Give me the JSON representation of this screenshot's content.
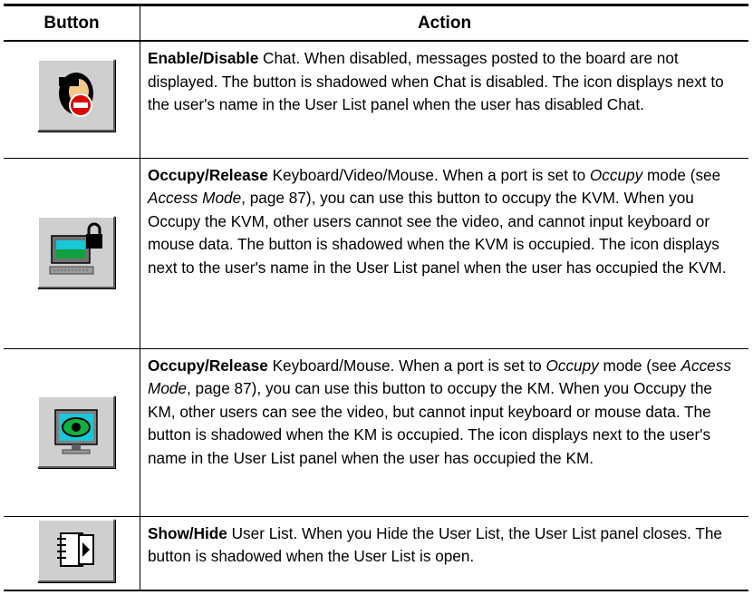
{
  "header": {
    "button": "Button",
    "action": "Action"
  },
  "rows": [
    {
      "icon": "chat-disabled-icon",
      "title": "Enable/Disable",
      "text": " Chat. When disabled, messages posted to the board are not displayed. The button is shadowed when Chat is disabled. The icon displays next to the user's name in the User List panel when the user has disabled Chat."
    },
    {
      "icon": "kvm-occupy-icon",
      "title": "Occupy/Release",
      "t1": " Keyboard/Video/Mouse. When a port is set to ",
      "i1": "Occupy",
      "t2": " mode (see ",
      "i2": "Access Mode",
      "t3": ", page 87), you can use this button to occupy the KVM. When you Occupy the KVM, other users cannot see the video, and cannot input keyboard or mouse data. The button is shadowed when the KVM is occupied. The icon displays next to the user's name in the User List panel when the user has occupied the KVM."
    },
    {
      "icon": "km-occupy-icon",
      "title": "Occupy/Release",
      "t1": " Keyboard/Mouse. When a port is set to ",
      "i1": "Occupy",
      "t2": " mode (see ",
      "i2": "Access Mode",
      "t3": ", page 87), you can use this button to occupy the KM. When you Occupy the KM, other users can see the video, but cannot input keyboard or mouse data. The button is shadowed when the KM is occupied. The icon displays next to the user's name in the User List panel when the user has occupied the KM."
    },
    {
      "icon": "user-list-icon",
      "title": "Show/Hide",
      "text": " User List. When you Hide the User List, the User List panel closes. The button is shadowed when the User List is open."
    }
  ]
}
